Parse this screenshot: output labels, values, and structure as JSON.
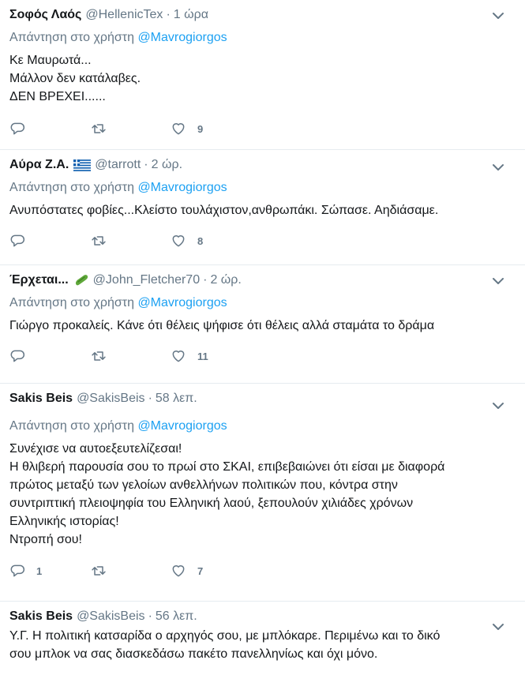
{
  "reply_prefix": "Απάντηση στο χρήστη",
  "tweets": [
    {
      "name": "Σοφός Λαός",
      "handle": "@HellenicTex",
      "time": "1 ώρα",
      "mention": "@Mavrogiorgos",
      "lines": [
        "Κε Μαυρωτά...",
        "Μάλλον δεν κατάλαβες.",
        "ΔΕΝ ΒΡΕΧΕΙ......"
      ],
      "replies": "",
      "retweets": "",
      "likes": "9"
    },
    {
      "name": "Αύρα Ζ.Α.",
      "emoji": "greek-flag",
      "handle": "@tarrott",
      "time": "2 ώρ.",
      "mention": "@Mavrogiorgos",
      "lines": [
        "Ανυπόστατες φοβίες...Κλείστο τουλάχιστον,ανθρωπάκι. Σώπασε. Αηδιάσαμε."
      ],
      "replies": "",
      "retweets": "",
      "likes": "8"
    },
    {
      "name": "Έρχεται...",
      "emoji": "cucumber",
      "handle": "@John_Fletcher70",
      "time": "2 ώρ.",
      "mention": "@Mavrogiorgos",
      "lines": [
        "Γιώργο προκαλείς. Κάνε ότι θέλεις ψήφισε ότι θέλεις αλλά σταμάτα το δράμα"
      ],
      "replies": "",
      "retweets": "",
      "likes": "11"
    },
    {
      "name": "Sakis Beis",
      "handle": "@SakisBeis",
      "time": "58 λεπ.",
      "mention": "@Mavrogiorgos",
      "lines": [
        "Συνέχισε να αυτοεξευτελίζεσαι!",
        "Η θλιβερή παρουσία σου το πρωί στο ΣΚΑΙ, επιβεβαιώνει ότι είσαι με διαφορά",
        "πρώτος μεταξύ των γελοίων ανθελλήνων πολιτικών που, κόντρα στην",
        "συντριπτική πλειοψηφία του Ελληνική λαού, ξεπουλούν χιλιάδες χρόνων",
        "Ελληνικής ιστορίας!",
        "Ντροπή σου!"
      ],
      "replies": "1",
      "retweets": "",
      "likes": "7"
    },
    {
      "name": "Sakis Beis",
      "handle": "@SakisBeis",
      "time": "56 λεπ.",
      "lines": [
        "Υ.Γ. Η πολιτική κατσαρίδα ο αρχηγός σου, με μπλόκαρε. Περιμένω και το δικό",
        "σου μπλοκ να σας διασκεδάσω πακέτο πανελληνίως και όχι μόνο."
      ]
    }
  ]
}
